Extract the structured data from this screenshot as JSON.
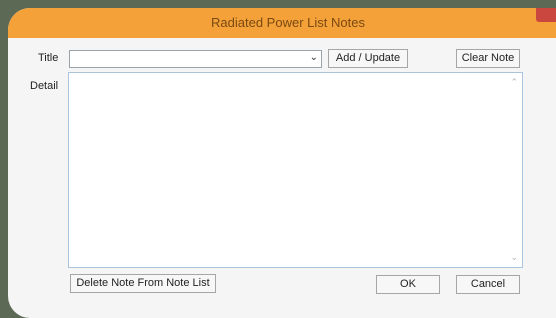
{
  "window": {
    "title": "Radiated Power List Notes"
  },
  "form": {
    "title_label": "Title",
    "title_value": "",
    "detail_label": "Detail",
    "detail_value": ""
  },
  "buttons": {
    "add_update": "Add / Update",
    "clear_note": "Clear Note",
    "delete_note": "Delete Note From Note List",
    "ok": "OK",
    "cancel": "Cancel"
  },
  "icons": {
    "dropdown": "chevron-down-icon",
    "scroll_up": "scroll-up-arrow-icon",
    "scroll_down": "scroll-down-arrow-icon"
  },
  "colors": {
    "titlebar": "#f4a13a",
    "close": "#c9473e",
    "background": "#5c6a55"
  }
}
